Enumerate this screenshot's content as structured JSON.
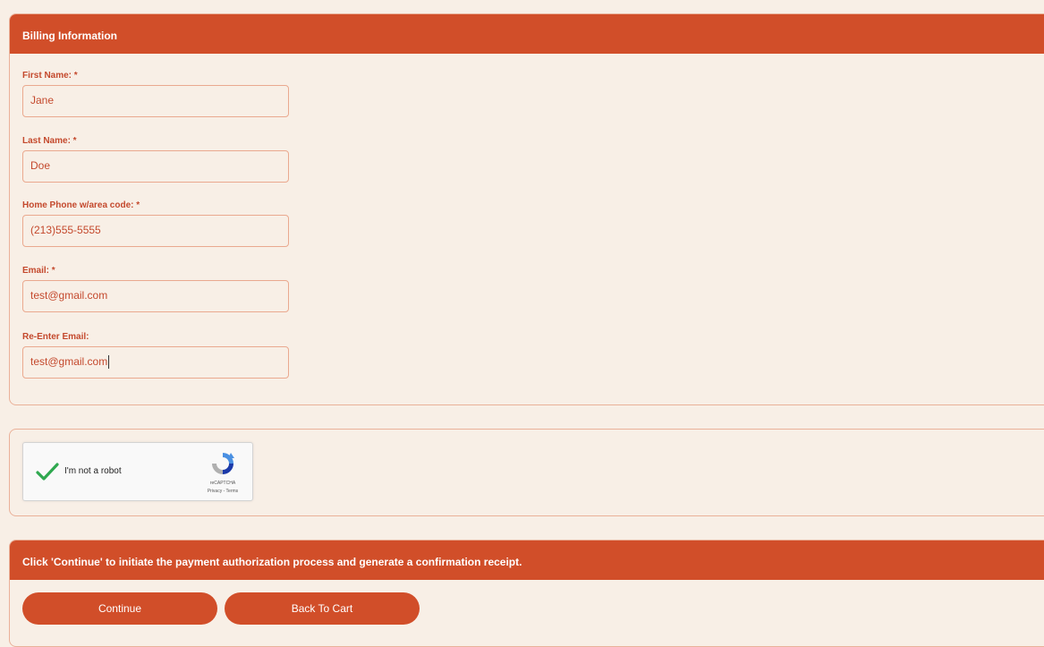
{
  "billing": {
    "header": "Billing Information",
    "fields": [
      {
        "label": "First Name: *",
        "value": "Jane"
      },
      {
        "label": "Last Name: *",
        "value": "Doe"
      },
      {
        "label": "Home Phone w/area code: *",
        "value": "(213)555-5555"
      },
      {
        "label": "Email: *",
        "value": "test@gmail.com"
      },
      {
        "label": "Re-Enter Email:",
        "value": "test@gmail.com"
      }
    ]
  },
  "captcha": {
    "label": "I'm not a robot",
    "brand": "reCAPTCHA",
    "links": "Privacy - Terms",
    "checked": true,
    "check_color": "#2fa84f",
    "icon": "recaptcha-logo-icon"
  },
  "submit": {
    "instructions": "Click 'Continue' to initiate the payment authorization process and generate a confirmation receipt.",
    "continue_label": "Continue",
    "back_label": "Back To Cart"
  },
  "colors": {
    "accent": "#d14e29",
    "background": "#f8efe6",
    "border": "#eab199",
    "label_text": "#c4492d"
  }
}
